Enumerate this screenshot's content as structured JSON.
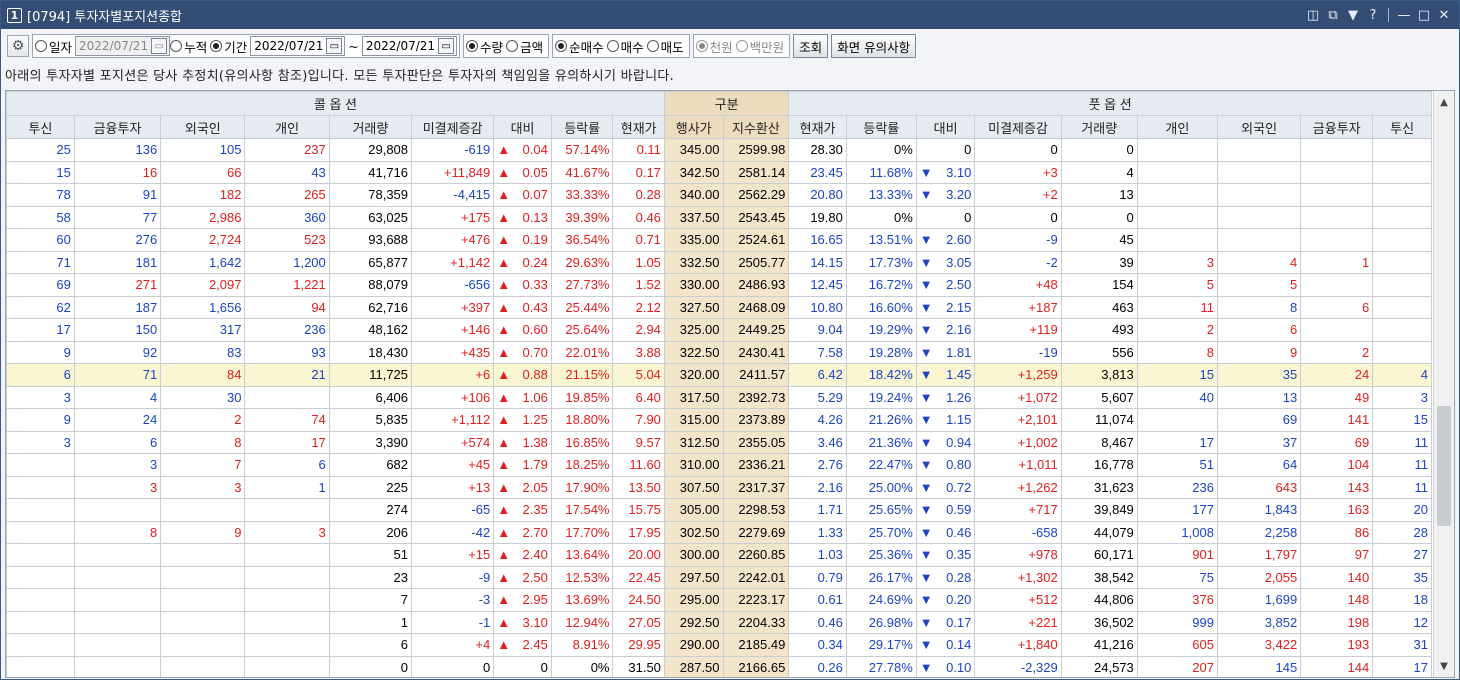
{
  "window": {
    "number": "1",
    "title": "[0794] 투자자별포지션종합"
  },
  "toolbar": {
    "opt_daily": "일자",
    "date_daily": "2022/07/21",
    "opt_cumulative": "누적",
    "opt_period": "기간",
    "date_from": "2022/07/21",
    "tilde": "~",
    "date_to": "2022/07/21",
    "opt_quantity": "수량",
    "opt_amount": "금액",
    "opt_netbuy": "순매수",
    "opt_buy": "매수",
    "opt_sell": "매도",
    "opt_won": "천원",
    "opt_million": "백만원",
    "search": "조회",
    "notice_btn": "화면 유의사항"
  },
  "notice": "아래의 투자자별 포지션은 당사 추정치(유의사항 참조)입니다. 모든 투자판단은 투자자의 책임임을 유의하시기 바랍니다.",
  "headers": {
    "call": "콜 옵 션",
    "middle": "구분",
    "put": "풋 옵 션",
    "cols": [
      "투신",
      "금융투자",
      "외국인",
      "개인",
      "거래량",
      "미결제증감",
      "대비",
      "등락률",
      "현재가",
      "행사가",
      "지수환산",
      "현재가",
      "등락률",
      "대비",
      "미결제증감",
      "거래량",
      "개인",
      "외국인",
      "금융투자",
      "투신"
    ]
  },
  "colors": {
    "up": "#e01f1f",
    "down": "#1c44c6",
    "middle": "#f3e5c9",
    "atm": "#fbf6d2"
  },
  "rows": [
    [
      "25",
      "136",
      "105",
      "237",
      "29,808",
      "-619",
      "▲",
      "0.04",
      "57.14%",
      "0.11",
      "345.00",
      "2599.98",
      "28.30",
      "0%",
      "",
      "0",
      "0",
      "0",
      "",
      "",
      "",
      ""
    ],
    [
      "15",
      "16",
      "66",
      "43",
      "41,716",
      "+11,849",
      "▲",
      "0.05",
      "41.67%",
      "0.17",
      "342.50",
      "2581.14",
      "23.45",
      "11.68%",
      "▼",
      "3.10",
      "+3",
      "4",
      "",
      "",
      "",
      ""
    ],
    [
      "78",
      "91",
      "182",
      "265",
      "78,359",
      "-4,415",
      "▲",
      "0.07",
      "33.33%",
      "0.28",
      "340.00",
      "2562.29",
      "20.80",
      "13.33%",
      "▼",
      "3.20",
      "+2",
      "13",
      "",
      "",
      "",
      ""
    ],
    [
      "58",
      "77",
      "2,986",
      "360",
      "63,025",
      "+175",
      "▲",
      "0.13",
      "39.39%",
      "0.46",
      "337.50",
      "2543.45",
      "19.80",
      "0%",
      "",
      "0",
      "0",
      "0",
      "",
      "",
      "",
      ""
    ],
    [
      "60",
      "276",
      "2,724",
      "523",
      "93,688",
      "+476",
      "▲",
      "0.19",
      "36.54%",
      "0.71",
      "335.00",
      "2524.61",
      "16.65",
      "13.51%",
      "▼",
      "2.60",
      "-9",
      "45",
      "",
      "",
      "",
      ""
    ],
    [
      "71",
      "181",
      "1,642",
      "1,200",
      "65,877",
      "+1,142",
      "▲",
      "0.24",
      "29.63%",
      "1.05",
      "332.50",
      "2505.77",
      "14.15",
      "17.73%",
      "▼",
      "3.05",
      "-2",
      "39",
      "3",
      "4",
      "1",
      ""
    ],
    [
      "69",
      "271",
      "2,097",
      "1,221",
      "88,079",
      "-656",
      "▲",
      "0.33",
      "27.73%",
      "1.52",
      "330.00",
      "2486.93",
      "12.45",
      "16.72%",
      "▼",
      "2.50",
      "+48",
      "154",
      "5",
      "5",
      "",
      ""
    ],
    [
      "62",
      "187",
      "1,656",
      "94",
      "62,716",
      "+397",
      "▲",
      "0.43",
      "25.44%",
      "2.12",
      "327.50",
      "2468.09",
      "10.80",
      "16.60%",
      "▼",
      "2.15",
      "+187",
      "463",
      "11",
      "8",
      "6",
      ""
    ],
    [
      "17",
      "150",
      "317",
      "236",
      "48,162",
      "+146",
      "▲",
      "0.60",
      "25.64%",
      "2.94",
      "325.00",
      "2449.25",
      "9.04",
      "19.29%",
      "▼",
      "2.16",
      "+119",
      "493",
      "2",
      "6",
      "",
      ""
    ],
    [
      "9",
      "92",
      "83",
      "93",
      "18,430",
      "+435",
      "▲",
      "0.70",
      "22.01%",
      "3.88",
      "322.50",
      "2430.41",
      "7.58",
      "19.28%",
      "▼",
      "1.81",
      "-19",
      "556",
      "8",
      "9",
      "2",
      ""
    ],
    [
      "6",
      "71",
      "84",
      "21",
      "11,725",
      "+6",
      "▲",
      "0.88",
      "21.15%",
      "5.04",
      "320.00",
      "2411.57",
      "6.42",
      "18.42%",
      "▼",
      "1.45",
      "+1,259",
      "3,813",
      "15",
      "35",
      "24",
      "4"
    ],
    [
      "3",
      "4",
      "30",
      "",
      "6,406",
      "+106",
      "▲",
      "1.06",
      "19.85%",
      "6.40",
      "317.50",
      "2392.73",
      "5.29",
      "19.24%",
      "▼",
      "1.26",
      "+1,072",
      "5,607",
      "40",
      "13",
      "49",
      "3"
    ],
    [
      "9",
      "24",
      "2",
      "74",
      "5,835",
      "+1,112",
      "▲",
      "1.25",
      "18.80%",
      "7.90",
      "315.00",
      "2373.89",
      "4.26",
      "21.26%",
      "▼",
      "1.15",
      "+2,101",
      "11,074",
      "",
      "69",
      "141",
      "15"
    ],
    [
      "3",
      "6",
      "8",
      "17",
      "3,390",
      "+574",
      "▲",
      "1.38",
      "16.85%",
      "9.57",
      "312.50",
      "2355.05",
      "3.46",
      "21.36%",
      "▼",
      "0.94",
      "+1,002",
      "8,467",
      "17",
      "37",
      "69",
      "11"
    ],
    [
      "",
      "3",
      "7",
      "6",
      "682",
      "+45",
      "▲",
      "1.79",
      "18.25%",
      "11.60",
      "310.00",
      "2336.21",
      "2.76",
      "22.47%",
      "▼",
      "0.80",
      "+1,011",
      "16,778",
      "51",
      "64",
      "104",
      "11"
    ],
    [
      "",
      "3",
      "3",
      "1",
      "225",
      "+13",
      "▲",
      "2.05",
      "17.90%",
      "13.50",
      "307.50",
      "2317.37",
      "2.16",
      "25.00%",
      "▼",
      "0.72",
      "+1,262",
      "31,623",
      "236",
      "643",
      "143",
      "11"
    ],
    [
      "",
      "",
      "",
      "",
      "274",
      "-65",
      "▲",
      "2.35",
      "17.54%",
      "15.75",
      "305.00",
      "2298.53",
      "1.71",
      "25.65%",
      "▼",
      "0.59",
      "+717",
      "39,849",
      "177",
      "1,843",
      "163",
      "20"
    ],
    [
      "",
      "8",
      "9",
      "3",
      "206",
      "-42",
      "▲",
      "2.70",
      "17.70%",
      "17.95",
      "302.50",
      "2279.69",
      "1.33",
      "25.70%",
      "▼",
      "0.46",
      "-658",
      "44,079",
      "1,008",
      "2,258",
      "86",
      "28"
    ],
    [
      "",
      "",
      "",
      "",
      "51",
      "+15",
      "▲",
      "2.40",
      "13.64%",
      "20.00",
      "300.00",
      "2260.85",
      "1.03",
      "25.36%",
      "▼",
      "0.35",
      "+978",
      "60,171",
      "901",
      "1,797",
      "97",
      "27"
    ],
    [
      "",
      "",
      "",
      "",
      "23",
      "-9",
      "▲",
      "2.50",
      "12.53%",
      "22.45",
      "297.50",
      "2242.01",
      "0.79",
      "26.17%",
      "▼",
      "0.28",
      "+1,302",
      "38,542",
      "75",
      "2,055",
      "140",
      "35"
    ],
    [
      "",
      "",
      "",
      "",
      "7",
      "-3",
      "▲",
      "2.95",
      "13.69%",
      "24.50",
      "295.00",
      "2223.17",
      "0.61",
      "24.69%",
      "▼",
      "0.20",
      "+512",
      "44,806",
      "376",
      "1,699",
      "148",
      "18"
    ],
    [
      "",
      "",
      "",
      "",
      "1",
      "-1",
      "▲",
      "3.10",
      "12.94%",
      "27.05",
      "292.50",
      "2204.33",
      "0.46",
      "26.98%",
      "▼",
      "0.17",
      "+221",
      "36,502",
      "999",
      "3,852",
      "198",
      "12"
    ],
    [
      "",
      "",
      "",
      "",
      "6",
      "+4",
      "▲",
      "2.45",
      "8.91%",
      "29.95",
      "290.00",
      "2185.49",
      "0.34",
      "29.17%",
      "▼",
      "0.14",
      "+1,840",
      "41,216",
      "605",
      "3,422",
      "193",
      "31"
    ],
    [
      "",
      "",
      "",
      "",
      "0",
      "0",
      "",
      "0",
      "0%",
      "31.50",
      "287.50",
      "2166.65",
      "0.26",
      "27.78%",
      "▼",
      "0.10",
      "-2,329",
      "24,573",
      "207",
      "145",
      "144",
      "17"
    ]
  ],
  "colorMap": [
    [
      "b",
      "b",
      "b",
      "r",
      "",
      "b",
      "r",
      "r",
      "r",
      "r",
      "",
      "",
      "",
      "",
      "",
      "",
      "",
      "",
      "",
      "",
      "",
      ""
    ],
    [
      "b",
      "r",
      "r",
      "b",
      "",
      "r",
      "r",
      "r",
      "r",
      "r",
      "",
      "",
      "b",
      "b",
      "b",
      "b",
      "r",
      "",
      "",
      "",
      "",
      ""
    ],
    [
      "b",
      "b",
      "r",
      "r",
      "",
      "b",
      "r",
      "r",
      "r",
      "r",
      "",
      "",
      "b",
      "b",
      "b",
      "b",
      "r",
      "",
      "",
      "",
      "",
      ""
    ],
    [
      "b",
      "b",
      "r",
      "b",
      "",
      "r",
      "r",
      "r",
      "r",
      "r",
      "",
      "",
      "",
      "",
      "",
      "",
      "",
      "",
      "",
      "",
      "",
      ""
    ],
    [
      "b",
      "b",
      "r",
      "r",
      "",
      "r",
      "r",
      "r",
      "r",
      "r",
      "",
      "",
      "b",
      "b",
      "b",
      "b",
      "b",
      "",
      "",
      "",
      "",
      ""
    ],
    [
      "b",
      "b",
      "b",
      "b",
      "",
      "r",
      "r",
      "r",
      "r",
      "r",
      "",
      "",
      "b",
      "b",
      "b",
      "b",
      "b",
      "",
      "r",
      "r",
      "r",
      ""
    ],
    [
      "b",
      "r",
      "r",
      "r",
      "",
      "b",
      "r",
      "r",
      "r",
      "r",
      "",
      "",
      "b",
      "b",
      "b",
      "b",
      "r",
      "",
      "r",
      "r",
      "",
      ""
    ],
    [
      "b",
      "b",
      "b",
      "r",
      "",
      "r",
      "r",
      "r",
      "r",
      "r",
      "",
      "",
      "b",
      "b",
      "b",
      "b",
      "r",
      "",
      "r",
      "b",
      "r",
      ""
    ],
    [
      "b",
      "b",
      "b",
      "b",
      "",
      "r",
      "r",
      "r",
      "r",
      "r",
      "",
      "",
      "b",
      "b",
      "b",
      "b",
      "r",
      "",
      "r",
      "r",
      "",
      ""
    ],
    [
      "b",
      "b",
      "b",
      "b",
      "",
      "r",
      "r",
      "r",
      "r",
      "r",
      "",
      "",
      "b",
      "b",
      "b",
      "b",
      "b",
      "",
      "r",
      "r",
      "r",
      ""
    ],
    [
      "b",
      "b",
      "r",
      "b",
      "",
      "r",
      "r",
      "r",
      "r",
      "r",
      "",
      "",
      "b",
      "b",
      "b",
      "b",
      "r",
      "",
      "b",
      "b",
      "r",
      "b"
    ],
    [
      "b",
      "b",
      "b",
      "",
      "",
      "r",
      "r",
      "r",
      "r",
      "r",
      "",
      "",
      "b",
      "b",
      "b",
      "b",
      "r",
      "",
      "b",
      "b",
      "r",
      "b"
    ],
    [
      "b",
      "b",
      "r",
      "r",
      "",
      "r",
      "r",
      "r",
      "r",
      "r",
      "",
      "",
      "b",
      "b",
      "b",
      "b",
      "r",
      "",
      "",
      "b",
      "r",
      "b"
    ],
    [
      "b",
      "b",
      "r",
      "r",
      "",
      "r",
      "r",
      "r",
      "r",
      "r",
      "",
      "",
      "b",
      "b",
      "b",
      "b",
      "r",
      "",
      "b",
      "b",
      "r",
      "b"
    ],
    [
      "",
      "b",
      "r",
      "b",
      "",
      "r",
      "r",
      "r",
      "r",
      "r",
      "",
      "",
      "b",
      "b",
      "b",
      "b",
      "r",
      "",
      "b",
      "b",
      "r",
      "b"
    ],
    [
      "",
      "r",
      "r",
      "b",
      "",
      "r",
      "r",
      "r",
      "r",
      "r",
      "",
      "",
      "b",
      "b",
      "b",
      "b",
      "r",
      "",
      "b",
      "r",
      "r",
      "b"
    ],
    [
      "",
      "",
      "",
      "",
      "",
      "b",
      "r",
      "r",
      "r",
      "r",
      "",
      "",
      "b",
      "b",
      "b",
      "b",
      "r",
      "",
      "b",
      "b",
      "r",
      "b"
    ],
    [
      "",
      "r",
      "r",
      "r",
      "",
      "b",
      "r",
      "r",
      "r",
      "r",
      "",
      "",
      "b",
      "b",
      "b",
      "b",
      "b",
      "",
      "b",
      "b",
      "r",
      "b"
    ],
    [
      "",
      "",
      "",
      "",
      "",
      "r",
      "r",
      "r",
      "r",
      "r",
      "",
      "",
      "b",
      "b",
      "b",
      "b",
      "r",
      "",
      "r",
      "r",
      "r",
      "b"
    ],
    [
      "",
      "",
      "",
      "",
      "",
      "b",
      "r",
      "r",
      "r",
      "r",
      "",
      "",
      "b",
      "b",
      "b",
      "b",
      "r",
      "",
      "b",
      "r",
      "r",
      "b"
    ],
    [
      "",
      "",
      "",
      "",
      "",
      "b",
      "r",
      "r",
      "r",
      "r",
      "",
      "",
      "b",
      "b",
      "b",
      "b",
      "r",
      "",
      "r",
      "b",
      "r",
      "b"
    ],
    [
      "",
      "",
      "",
      "",
      "",
      "b",
      "r",
      "r",
      "r",
      "r",
      "",
      "",
      "b",
      "b",
      "b",
      "b",
      "r",
      "",
      "b",
      "b",
      "r",
      "b"
    ],
    [
      "",
      "",
      "",
      "",
      "",
      "r",
      "r",
      "r",
      "r",
      "r",
      "",
      "",
      "b",
      "b",
      "b",
      "b",
      "r",
      "",
      "r",
      "r",
      "r",
      "b"
    ],
    [
      "",
      "",
      "",
      "",
      "",
      "",
      "",
      "",
      "",
      "",
      "",
      "",
      "b",
      "b",
      "b",
      "b",
      "b",
      "",
      "r",
      "b",
      "r",
      "b"
    ]
  ],
  "atm_row": 10
}
